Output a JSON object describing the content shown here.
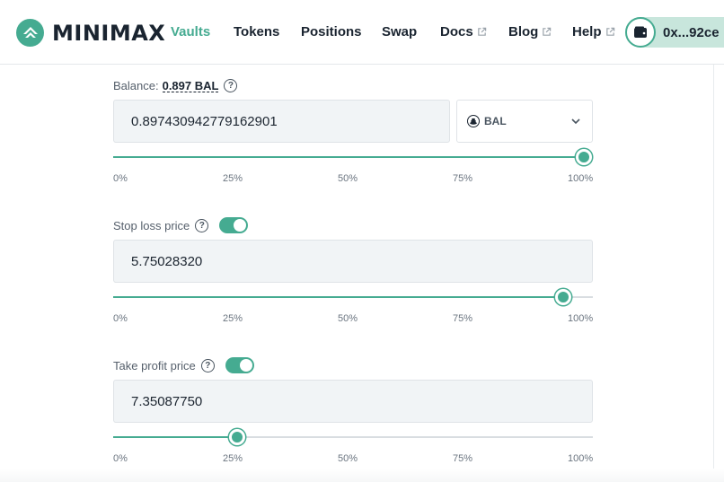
{
  "brand": {
    "name": "MINIMAX",
    "color": "#45ab91"
  },
  "nav": [
    {
      "label": "Vaults",
      "active": true,
      "external": false
    },
    {
      "label": "Tokens",
      "active": false,
      "external": false
    },
    {
      "label": "Positions",
      "active": false,
      "external": false
    },
    {
      "label": "Swap",
      "active": false,
      "external": false
    },
    {
      "label": "Docs",
      "active": false,
      "external": true
    },
    {
      "label": "Blog",
      "active": false,
      "external": true
    },
    {
      "label": "Help",
      "active": false,
      "external": true
    }
  ],
  "wallet": {
    "address": "0x...92ce",
    "icon": "wallet-icon"
  },
  "balance": {
    "label": "Balance:",
    "value": "0.897 BAL",
    "amount_input": "0.897430942779162901",
    "token": "BAL",
    "slider_percent": 100
  },
  "stop_loss": {
    "label": "Stop loss price",
    "enabled": true,
    "value": "5.75028320",
    "slider_percent": 95.6
  },
  "take_profit": {
    "label": "Take profit price",
    "enabled": true,
    "value": "7.35087750",
    "slider_percent": 25
  },
  "ticks": [
    "0%",
    "25%",
    "50%",
    "75%",
    "100%"
  ]
}
